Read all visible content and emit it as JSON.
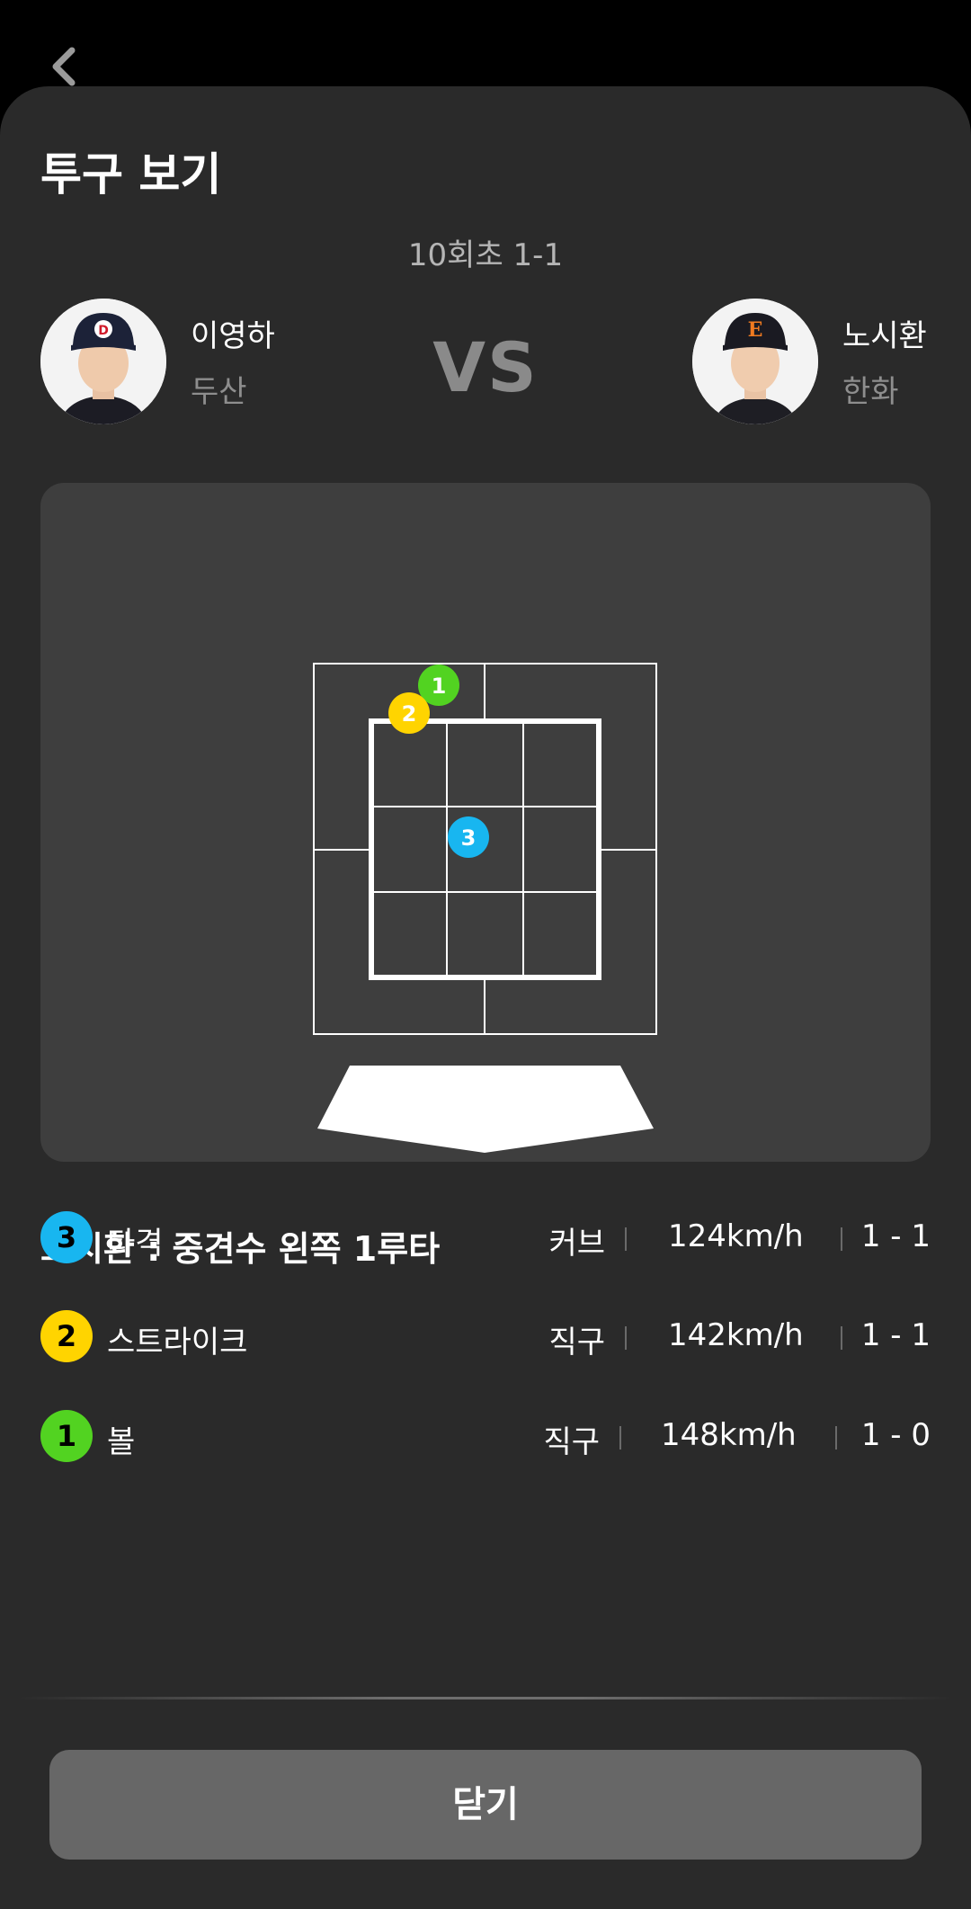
{
  "header": {
    "title": "투구 보기",
    "inning": "10회초 1-1"
  },
  "matchup": {
    "left": {
      "name": "이영하",
      "team": "두산"
    },
    "vs": "VS",
    "right": {
      "name": "노시환",
      "team": "한화"
    }
  },
  "zone_pitches": [
    {
      "number": "1",
      "color": "#52d321"
    },
    {
      "number": "2",
      "color": "#ffd400"
    },
    {
      "number": "3",
      "color": "#18b6f0"
    }
  ],
  "result": "노시환 : 중견수 왼쪽 1루타",
  "pitches": [
    {
      "number": "3",
      "label": "타격",
      "type": "커브",
      "speed": "124km/h",
      "count": "1 - 1",
      "color": "#18b6f0"
    },
    {
      "number": "2",
      "label": "스트라이크",
      "type": "직구",
      "speed": "142km/h",
      "count": "1 - 1",
      "color": "#ffd400"
    },
    {
      "number": "1",
      "label": "볼",
      "type": "직구",
      "speed": "148km/h",
      "count": "1 - 0",
      "color": "#52d321"
    }
  ],
  "close_button": "닫기"
}
